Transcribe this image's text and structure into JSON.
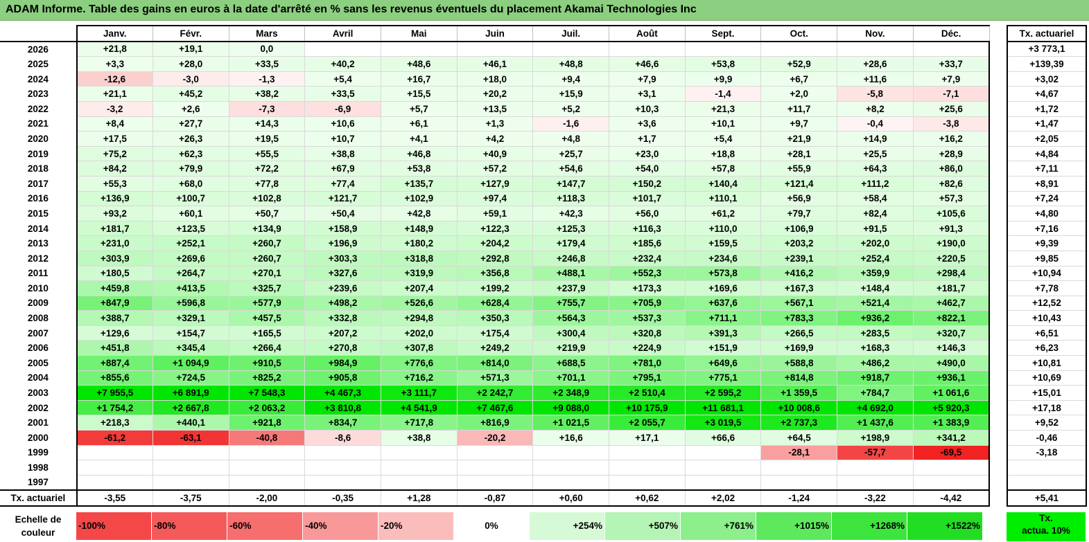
{
  "title": "ADAM Informe. Table des gains en euros à la date d'arrêté en % sans les revenus éventuels du placement Akamai Technologies Inc",
  "months": [
    "Janv.",
    "Févr.",
    "Mars",
    "Avril",
    "Mai",
    "Juin",
    "Juil.",
    "Août",
    "Sept.",
    "Oct.",
    "Nov.",
    "Déc."
  ],
  "side_header": "Tx. actuariel",
  "rows": [
    {
      "year": "2026",
      "values": [
        "+21,8",
        "+19,1",
        "0,0",
        "",
        "",
        "",
        "",
        "",
        "",
        "",
        "",
        ""
      ],
      "rate": "+3 773,1"
    },
    {
      "year": "2025",
      "values": [
        "+3,3",
        "+28,0",
        "+33,5",
        "+40,2",
        "+48,6",
        "+46,1",
        "+48,8",
        "+46,6",
        "+53,8",
        "+52,9",
        "+28,6",
        "+33,7"
      ],
      "rate": "+139,39"
    },
    {
      "year": "2024",
      "values": [
        "-12,6",
        "-3,0",
        "-1,3",
        "+5,4",
        "+16,7",
        "+18,0",
        "+9,4",
        "+7,9",
        "+9,9",
        "+6,7",
        "+11,6",
        "+7,9"
      ],
      "rate": "+3,02"
    },
    {
      "year": "2023",
      "values": [
        "+21,1",
        "+45,2",
        "+38,2",
        "+33,5",
        "+15,5",
        "+20,2",
        "+15,9",
        "+3,1",
        "-1,4",
        "+2,0",
        "-5,8",
        "-7,1"
      ],
      "rate": "+4,67"
    },
    {
      "year": "2022",
      "values": [
        "-3,2",
        "+2,6",
        "-7,3",
        "-6,9",
        "+5,7",
        "+13,5",
        "+5,2",
        "+10,3",
        "+21,3",
        "+11,7",
        "+8,2",
        "+25,6"
      ],
      "rate": "+1,72"
    },
    {
      "year": "2021",
      "values": [
        "+8,4",
        "+27,7",
        "+14,3",
        "+10,6",
        "+6,1",
        "+1,3",
        "-1,6",
        "+3,6",
        "+10,1",
        "+9,7",
        "-0,4",
        "-3,8"
      ],
      "rate": "+1,47"
    },
    {
      "year": "2020",
      "values": [
        "+17,5",
        "+26,3",
        "+19,5",
        "+10,7",
        "+4,1",
        "+4,2",
        "+4,8",
        "+1,7",
        "+5,4",
        "+21,9",
        "+14,9",
        "+16,2"
      ],
      "rate": "+2,05"
    },
    {
      "year": "2019",
      "values": [
        "+75,2",
        "+62,3",
        "+55,5",
        "+38,8",
        "+46,8",
        "+40,9",
        "+25,7",
        "+23,0",
        "+18,8",
        "+28,1",
        "+25,5",
        "+28,9"
      ],
      "rate": "+4,84"
    },
    {
      "year": "2018",
      "values": [
        "+84,2",
        "+79,9",
        "+72,2",
        "+67,9",
        "+53,8",
        "+57,2",
        "+54,6",
        "+54,0",
        "+57,8",
        "+55,9",
        "+64,3",
        "+86,0"
      ],
      "rate": "+7,11"
    },
    {
      "year": "2017",
      "values": [
        "+55,3",
        "+68,0",
        "+77,8",
        "+77,4",
        "+135,7",
        "+127,9",
        "+147,7",
        "+150,2",
        "+140,4",
        "+121,4",
        "+111,2",
        "+82,6"
      ],
      "rate": "+8,91"
    },
    {
      "year": "2016",
      "values": [
        "+136,9",
        "+100,7",
        "+102,8",
        "+121,7",
        "+102,9",
        "+97,4",
        "+118,3",
        "+101,7",
        "+110,1",
        "+56,9",
        "+58,4",
        "+57,3"
      ],
      "rate": "+7,24"
    },
    {
      "year": "2015",
      "values": [
        "+93,2",
        "+60,1",
        "+50,7",
        "+50,4",
        "+42,8",
        "+59,1",
        "+42,3",
        "+56,0",
        "+61,2",
        "+79,7",
        "+82,4",
        "+105,6"
      ],
      "rate": "+4,80"
    },
    {
      "year": "2014",
      "values": [
        "+181,7",
        "+123,5",
        "+134,9",
        "+158,9",
        "+148,9",
        "+122,3",
        "+125,3",
        "+116,3",
        "+110,0",
        "+106,9",
        "+91,5",
        "+91,3"
      ],
      "rate": "+7,16"
    },
    {
      "year": "2013",
      "values": [
        "+231,0",
        "+252,1",
        "+260,7",
        "+196,9",
        "+180,2",
        "+204,2",
        "+179,4",
        "+185,6",
        "+159,5",
        "+203,2",
        "+202,0",
        "+190,0"
      ],
      "rate": "+9,39"
    },
    {
      "year": "2012",
      "values": [
        "+303,9",
        "+269,6",
        "+260,7",
        "+303,3",
        "+318,8",
        "+292,8",
        "+246,8",
        "+232,4",
        "+234,6",
        "+239,1",
        "+252,4",
        "+220,5"
      ],
      "rate": "+9,85"
    },
    {
      "year": "2011",
      "values": [
        "+180,5",
        "+264,7",
        "+270,1",
        "+327,6",
        "+319,9",
        "+356,8",
        "+488,1",
        "+552,3",
        "+573,8",
        "+416,2",
        "+359,9",
        "+298,4"
      ],
      "rate": "+10,94"
    },
    {
      "year": "2010",
      "values": [
        "+459,8",
        "+413,5",
        "+325,7",
        "+239,6",
        "+207,4",
        "+199,2",
        "+237,9",
        "+173,3",
        "+169,6",
        "+167,3",
        "+148,4",
        "+181,7"
      ],
      "rate": "+7,78"
    },
    {
      "year": "2009",
      "values": [
        "+847,9",
        "+596,8",
        "+577,9",
        "+498,2",
        "+526,6",
        "+628,4",
        "+755,7",
        "+705,9",
        "+637,6",
        "+567,1",
        "+521,4",
        "+462,7"
      ],
      "rate": "+12,52"
    },
    {
      "year": "2008",
      "values": [
        "+388,7",
        "+329,1",
        "+457,5",
        "+332,8",
        "+294,8",
        "+350,3",
        "+564,3",
        "+537,3",
        "+711,1",
        "+783,3",
        "+936,2",
        "+822,1"
      ],
      "rate": "+10,43"
    },
    {
      "year": "2007",
      "values": [
        "+129,6",
        "+154,7",
        "+165,5",
        "+207,2",
        "+202,0",
        "+175,4",
        "+300,4",
        "+320,8",
        "+391,3",
        "+266,5",
        "+283,5",
        "+320,7"
      ],
      "rate": "+6,51"
    },
    {
      "year": "2006",
      "values": [
        "+451,8",
        "+345,4",
        "+266,4",
        "+270,8",
        "+307,8",
        "+249,2",
        "+219,9",
        "+224,9",
        "+151,9",
        "+169,9",
        "+168,3",
        "+146,3"
      ],
      "rate": "+6,23"
    },
    {
      "year": "2005",
      "values": [
        "+887,4",
        "+1 094,9",
        "+910,5",
        "+984,9",
        "+776,6",
        "+814,0",
        "+688,5",
        "+781,0",
        "+649,6",
        "+588,8",
        "+486,2",
        "+490,0"
      ],
      "rate": "+10,81"
    },
    {
      "year": "2004",
      "values": [
        "+855,6",
        "+724,5",
        "+825,2",
        "+905,8",
        "+716,2",
        "+571,3",
        "+701,1",
        "+795,1",
        "+775,1",
        "+814,8",
        "+918,7",
        "+936,1"
      ],
      "rate": "+10,69"
    },
    {
      "year": "2003",
      "values": [
        "+7 955,5",
        "+6 891,9",
        "+7 548,3",
        "+4 467,3",
        "+3 111,7",
        "+2 242,7",
        "+2 348,9",
        "+2 510,4",
        "+2 595,2",
        "+1 359,5",
        "+784,7",
        "+1 061,6"
      ],
      "rate": "+15,01"
    },
    {
      "year": "2002",
      "values": [
        "+1 754,2",
        "+2 667,8",
        "+2 063,2",
        "+3 810,8",
        "+4 541,9",
        "+7 467,6",
        "+9 088,0",
        "+10 175,9",
        "+11 681,1",
        "+10 008,6",
        "+4 692,0",
        "+5 920,3"
      ],
      "rate": "+17,18"
    },
    {
      "year": "2001",
      "values": [
        "+218,3",
        "+440,1",
        "+921,8",
        "+834,7",
        "+717,8",
        "+816,9",
        "+1 021,5",
        "+2 055,7",
        "+3 019,5",
        "+2 737,3",
        "+1 437,6",
        "+1 383,9"
      ],
      "rate": "+9,52"
    },
    {
      "year": "2000",
      "values": [
        "-61,2",
        "-63,1",
        "-40,8",
        "-8,6",
        "+38,8",
        "-20,2",
        "+16,6",
        "+17,1",
        "+66,6",
        "+64,5",
        "+198,9",
        "+341,2"
      ],
      "rate": "-0,46"
    },
    {
      "year": "1999",
      "values": [
        "",
        "",
        "",
        "",
        "",
        "",
        "",
        "",
        "",
        "-28,1",
        "-57,7",
        "-69,5"
      ],
      "rate": "-3,18"
    },
    {
      "year": "1998",
      "values": [
        "",
        "",
        "",
        "",
        "",
        "",
        "",
        "",
        "",
        "",
        "",
        ""
      ],
      "rate": ""
    },
    {
      "year": "1997",
      "values": [
        "",
        "",
        "",
        "",
        "",
        "",
        "",
        "",
        "",
        "",
        "",
        ""
      ],
      "rate": ""
    }
  ],
  "footer": {
    "label": "Tx. actuariel",
    "values": [
      "-3,55",
      "-3,75",
      "-2,00",
      "-0,35",
      "+1,28",
      "-0,87",
      "+0,60",
      "+0,62",
      "+2,02",
      "-1,24",
      "-3,22",
      "-4,42"
    ],
    "rate": "+5,41"
  },
  "legend": {
    "label_line1": "Echelle de",
    "label_line2": "couleur",
    "swatches": [
      {
        "text": "-100%",
        "color": "#f44848",
        "align": "left"
      },
      {
        "text": "-80%",
        "color": "#f55a5a",
        "align": "left"
      },
      {
        "text": "-60%",
        "color": "#f66e6e",
        "align": "left"
      },
      {
        "text": "-40%",
        "color": "#f89898",
        "align": "left"
      },
      {
        "text": "-20%",
        "color": "#fbbcbc",
        "align": "left"
      },
      {
        "text": "0%",
        "color": "#ffffff",
        "align": "center"
      },
      {
        "text": "+254%",
        "color": "#d6f9d6",
        "align": "right"
      },
      {
        "text": "+507%",
        "color": "#b4f4b4",
        "align": "right"
      },
      {
        "text": "+761%",
        "color": "#8cef8c",
        "align": "right"
      },
      {
        "text": "+1015%",
        "color": "#5ee85e",
        "align": "right"
      },
      {
        "text": "+1268%",
        "color": "#3ee43e",
        "align": "right"
      },
      {
        "text": "+1522%",
        "color": "#22de22",
        "align": "right"
      }
    ],
    "side_line1": "Tx.",
    "side_line2": "actua. 10%",
    "side_color": "#00ee00"
  }
}
